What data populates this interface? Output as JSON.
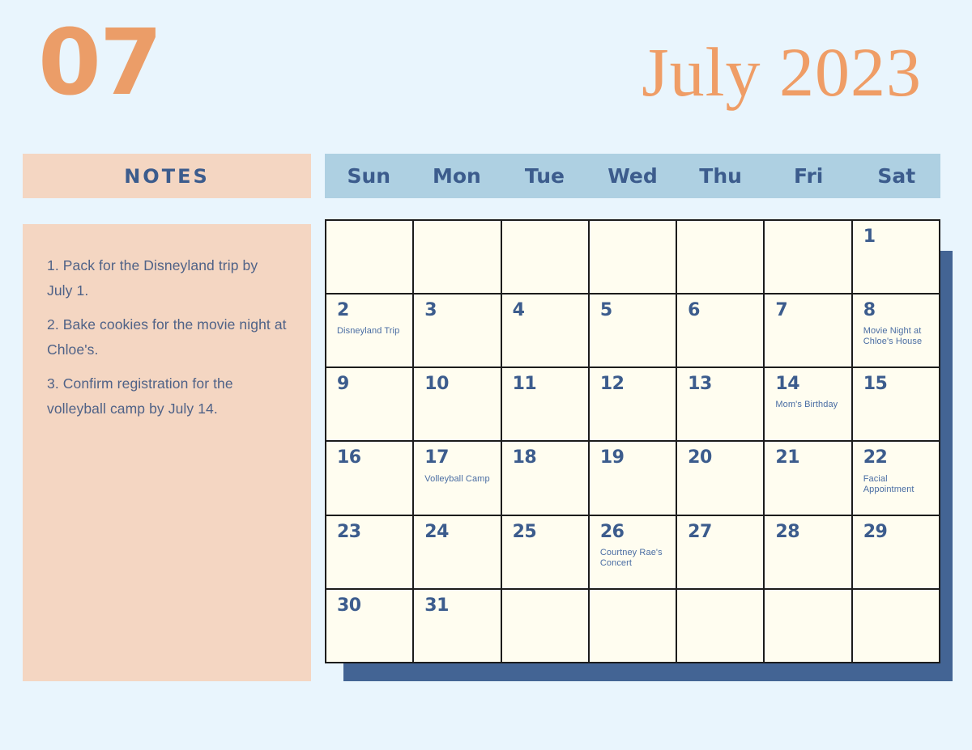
{
  "header": {
    "month_number": "07",
    "title": "July 2023"
  },
  "notes": {
    "header_label": "NOTES",
    "items": [
      "1. Pack for the Disneyland trip by July 1.",
      "2. Bake cookies for the movie night at Chloe's.",
      "3. Confirm registration for the volleyball camp by July 14."
    ]
  },
  "calendar": {
    "weekdays": [
      "Sun",
      "Mon",
      "Tue",
      "Wed",
      "Thu",
      "Fri",
      "Sat"
    ],
    "cells": [
      {
        "day": "",
        "event": ""
      },
      {
        "day": "",
        "event": ""
      },
      {
        "day": "",
        "event": ""
      },
      {
        "day": "",
        "event": ""
      },
      {
        "day": "",
        "event": ""
      },
      {
        "day": "",
        "event": ""
      },
      {
        "day": "1",
        "event": ""
      },
      {
        "day": "2",
        "event": "Disneyland Trip"
      },
      {
        "day": "3",
        "event": ""
      },
      {
        "day": "4",
        "event": ""
      },
      {
        "day": "5",
        "event": ""
      },
      {
        "day": "6",
        "event": ""
      },
      {
        "day": "7",
        "event": ""
      },
      {
        "day": "8",
        "event": "Movie Night at Chloe's House"
      },
      {
        "day": "9",
        "event": ""
      },
      {
        "day": "10",
        "event": ""
      },
      {
        "day": "11",
        "event": ""
      },
      {
        "day": "12",
        "event": ""
      },
      {
        "day": "13",
        "event": ""
      },
      {
        "day": "14",
        "event": "Mom's Birthday"
      },
      {
        "day": "15",
        "event": ""
      },
      {
        "day": "16",
        "event": ""
      },
      {
        "day": "17",
        "event": "Volleyball Camp"
      },
      {
        "day": "18",
        "event": ""
      },
      {
        "day": "19",
        "event": ""
      },
      {
        "day": "20",
        "event": ""
      },
      {
        "day": "21",
        "event": ""
      },
      {
        "day": "22",
        "event": "Facial Appointment"
      },
      {
        "day": "23",
        "event": ""
      },
      {
        "day": "24",
        "event": ""
      },
      {
        "day": "25",
        "event": ""
      },
      {
        "day": "26",
        "event": "Courtney Rae's Concert"
      },
      {
        "day": "27",
        "event": ""
      },
      {
        "day": "28",
        "event": ""
      },
      {
        "day": "29",
        "event": ""
      },
      {
        "day": "30",
        "event": ""
      },
      {
        "day": "31",
        "event": ""
      },
      {
        "day": "",
        "event": ""
      },
      {
        "day": "",
        "event": ""
      },
      {
        "day": "",
        "event": ""
      },
      {
        "day": "",
        "event": ""
      },
      {
        "day": "",
        "event": ""
      }
    ]
  },
  "colors": {
    "page_background": "#e9f5fd",
    "accent_orange": "#ef9d66",
    "peach_panel": "#f4d6c2",
    "weekday_bar": "#aed0e2",
    "deep_blue": "#3c5c8d",
    "shadow_blue": "#436494",
    "cell_cream": "#fffdf0"
  }
}
